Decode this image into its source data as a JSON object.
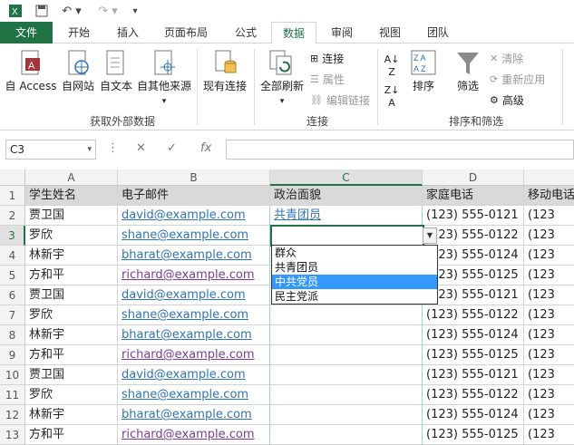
{
  "qat": {
    "undo_icon": "undo-icon",
    "redo_icon": "redo-icon",
    "save_icon": "save-icon"
  },
  "tabs": [
    {
      "label": "文件",
      "state": "file"
    },
    {
      "label": "开始"
    },
    {
      "label": "插入"
    },
    {
      "label": "页面布局"
    },
    {
      "label": "公式"
    },
    {
      "label": "数据",
      "state": "active"
    },
    {
      "label": "审阅"
    },
    {
      "label": "视图"
    },
    {
      "label": "团队"
    }
  ],
  "ribbon": {
    "external": {
      "access": "自 Access",
      "web": "自网站",
      "text": "自文本",
      "other": "自其他来源",
      "group": "获取外部数据"
    },
    "existing": "现有连接",
    "connections": {
      "refresh_all": "全部刷新",
      "connect": "连接",
      "properties": "属性",
      "edit_links": "编辑链接",
      "group": "连接"
    },
    "sort_filter": {
      "sort": "排序",
      "filter": "筛选",
      "clear": "清除",
      "reapply": "重新应用",
      "advanced": "高级",
      "group": "排序和筛选"
    }
  },
  "formula_bar": {
    "name_box": "C3",
    "fx": "fx",
    "value": ""
  },
  "columns": [
    "A",
    "B",
    "C",
    "D"
  ],
  "row_numbers": [
    "1",
    "2",
    "3",
    "4",
    "5",
    "6",
    "7",
    "8",
    "9",
    "10",
    "11",
    "12",
    "13"
  ],
  "header_row": [
    "学生姓名",
    "电子邮件",
    "政治面貌",
    "家庭电话",
    "移动电话"
  ],
  "rows": [
    {
      "name": "贾卫国",
      "email": "david@example.com",
      "pol": "共青团员",
      "phone": "(123) 555-0121",
      "mobile": "(123"
    },
    {
      "name": "罗欣",
      "email": "shane@example.com",
      "pol": "",
      "phone": "(123) 555-0122",
      "mobile": "(123"
    },
    {
      "name": "林新宇",
      "email": "bharat@example.com",
      "pol": "",
      "phone": "(123) 555-0124",
      "mobile": "(123"
    },
    {
      "name": "方和平",
      "email": "richard@example.com",
      "pol": "",
      "phone": "(123) 555-0125",
      "mobile": "(123"
    },
    {
      "name": "贾卫国",
      "email": "david@example.com",
      "pol": "",
      "phone": "(123) 555-0121",
      "mobile": "(123"
    },
    {
      "name": "罗欣",
      "email": "shane@example.com",
      "pol": "",
      "phone": "(123) 555-0122",
      "mobile": "(123"
    },
    {
      "name": "林新宇",
      "email": "bharat@example.com",
      "pol": "",
      "phone": "(123) 555-0124",
      "mobile": "(123"
    },
    {
      "name": "方和平",
      "email": "richard@example.com",
      "pol": "",
      "phone": "(123) 555-0125",
      "mobile": "(123"
    },
    {
      "name": "贾卫国",
      "email": "david@example.com",
      "pol": "",
      "phone": "(123) 555-0121",
      "mobile": "(123"
    },
    {
      "name": "罗欣",
      "email": "shane@example.com",
      "pol": "",
      "phone": "(123) 555-0122",
      "mobile": "(123"
    },
    {
      "name": "林新宇",
      "email": "bharat@example.com",
      "pol": "",
      "phone": "(123) 555-0124",
      "mobile": "(123"
    },
    {
      "name": "方和平",
      "email": "richard@example.com",
      "pol": "",
      "phone": "(123) 555-0125",
      "mobile": "(123"
    }
  ],
  "dropdown": {
    "options": [
      "群众",
      "共青团员",
      "中共党员",
      "民主党派"
    ],
    "highlighted": "中共党员"
  },
  "colors": {
    "accent": "#217346",
    "link": "#2e75b6",
    "visited_link": "#7a3a9a",
    "highlight": "#3399ff"
  }
}
